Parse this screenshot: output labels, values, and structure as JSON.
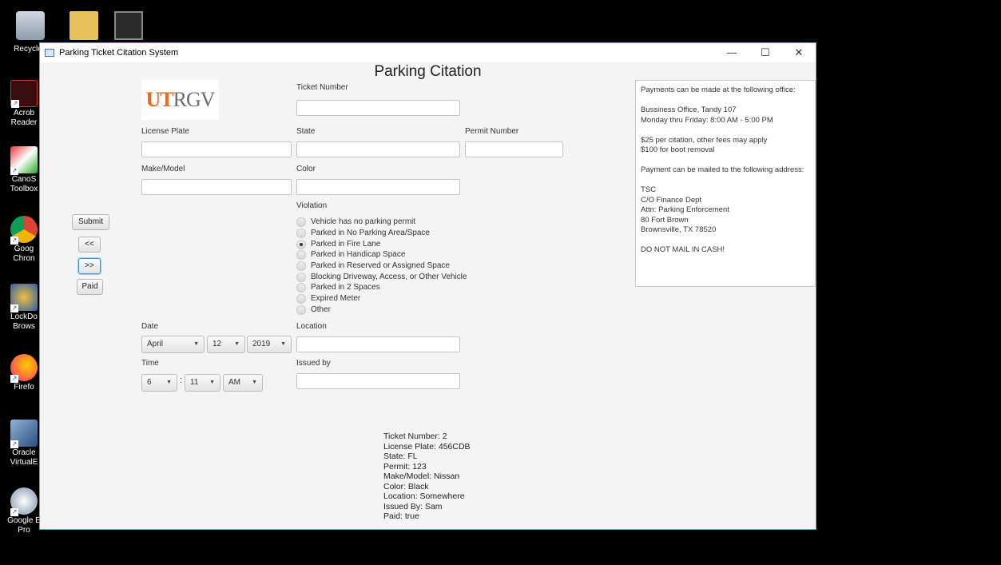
{
  "desktop": {
    "icons": [
      {
        "label": "Recycle",
        "icon": "recycle-bin-icon"
      },
      {
        "label": "Acrob Reader",
        "icon": "acrobat-reader-icon"
      },
      {
        "label": "CanoS Toolbox",
        "icon": "canon-toolbox-icon"
      },
      {
        "label": "Goog Chron",
        "icon": "google-chrome-icon"
      },
      {
        "label": "LockDo Brows",
        "icon": "lockdown-browser-icon"
      },
      {
        "label": "Firefo",
        "icon": "firefox-icon"
      },
      {
        "label": "Oracle VirtualE",
        "icon": "virtualbox-icon"
      },
      {
        "label": "Google E Pro",
        "icon": "google-earth-pro-icon"
      }
    ]
  },
  "window": {
    "title": "Parking Ticket Citation System",
    "minimize": "—",
    "maximize": "☐",
    "close": "✕"
  },
  "form": {
    "heading": "Parking Citation",
    "logo_ut": "UT",
    "logo_rgv": "RGV",
    "ticket_number_label": "Ticket Number",
    "license_plate_label": "License Plate",
    "state_label": "State",
    "permit_number_label": "Permit Number",
    "make_model_label": "Make/Model",
    "color_label": "Color",
    "violation_label": "Violation",
    "violations": [
      "Vehicle has no parking permit",
      "Parked in No Parking Area/Space",
      "Parked in Fire Lane",
      "Parked in Handicap Space",
      "Parked in Reserved or Assigned Space",
      "Blocking Driveway, Access, or Other Vehicle",
      "Parked in 2 Spaces",
      "Expired Meter",
      "Other"
    ],
    "selected_violation": "Parked in Fire Lane",
    "date_label": "Date",
    "date_month": "April",
    "date_day": "12",
    "date_year": "2019",
    "location_label": "Location",
    "time_label": "Time",
    "time_hour": "6",
    "time_minute": "11",
    "time_ampm": "AM",
    "time_separator": ":",
    "issued_by_label": "Issued by"
  },
  "buttons": {
    "submit": "Submit",
    "prev": "<<",
    "next": ">>",
    "paid": "Paid"
  },
  "info": {
    "lines": [
      "Payments can be made at the following office:",
      "",
      "Bussiness Office, Tandy 107",
      "Monday thru Friday: 8:00 AM - 5:00 PM",
      "",
      "$25 per citation, other fees may apply",
      "$100 for boot removal",
      "",
      "Payment can be mailed to the following address:",
      "",
      "TSC",
      "C/O Finance Dept",
      "Attn: Parking Enforcement",
      "80 Fort Brown",
      "Brownsville, TX 78520",
      "",
      "DO NOT MAIL IN CASH!"
    ]
  },
  "output": {
    "lines": [
      "Ticket Number: 2",
      "License Plate: 456CDB",
      "State: FL",
      "Permit: 123",
      "Make/Model: Nissan",
      "Color: Black",
      "Location: Somewhere",
      "Issued By: Sam",
      "Paid: true"
    ]
  }
}
